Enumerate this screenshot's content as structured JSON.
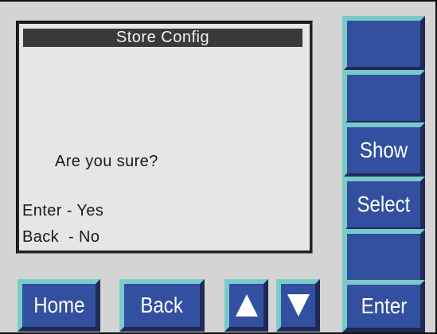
{
  "screen": {
    "title": "Store Config",
    "prompt": "Are you sure?",
    "option_yes": "Enter - Yes",
    "option_no": "Back  - No"
  },
  "side_buttons": {
    "button_1": "",
    "button_2": "",
    "show": "Show",
    "select": "Select",
    "button_5": "",
    "enter": "Enter"
  },
  "bottom_buttons": {
    "home": "Home",
    "back": "Back",
    "up_icon": "up-arrow-icon",
    "down_icon": "down-arrow-icon"
  },
  "colors": {
    "panel": "#d4d4d4",
    "button_face": "#3350a0",
    "button_highlight": "#79cbc8",
    "screen": "#e6e6e6",
    "title_bar": "#3a3a3a"
  }
}
